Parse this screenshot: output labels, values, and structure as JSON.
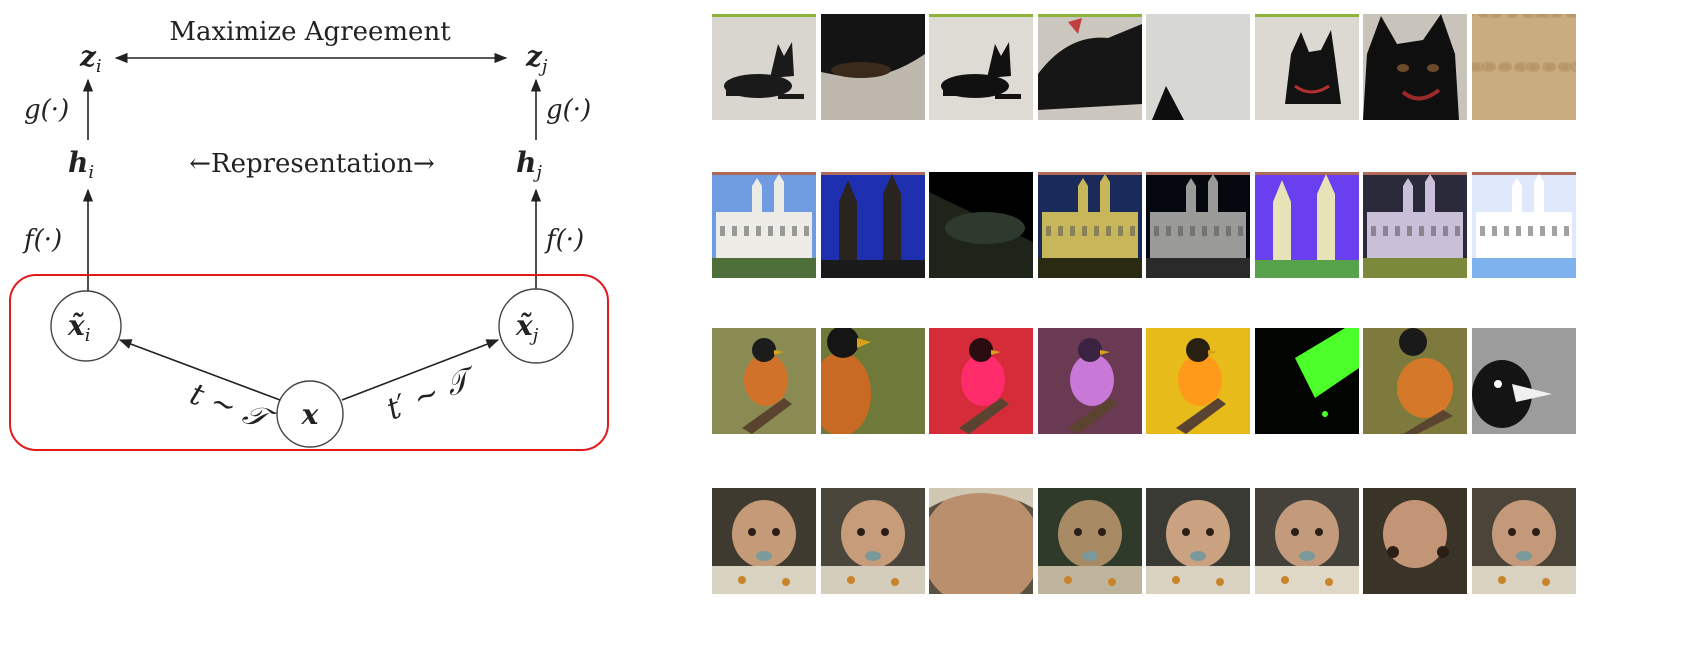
{
  "diagram": {
    "top_label": "Maximize Agreement",
    "mid_label": "←Representation→",
    "z_i": "z",
    "z_i_sub": "i",
    "z_j": "z",
    "z_j_sub": "j",
    "h_i": "h",
    "h_i_sub": "i",
    "h_j": "h",
    "h_j_sub": "j",
    "g_i": "g(·)",
    "g_j": "g(·)",
    "f_i": "f(·)",
    "f_j": "f(·)",
    "xt_i": "x̃",
    "xt_i_sub": "i",
    "xt_j": "x̃",
    "xt_j_sub": "j",
    "x": "x",
    "t_left": "t ∼ 𝒯",
    "t_right": "t′ ∼ 𝒯",
    "colors": {
      "box": "#e31a1c",
      "ink": "#222222"
    }
  },
  "augmentation_rows": [
    {
      "name": "dog",
      "tiles": [
        {
          "kind": "dog-full",
          "bg": "#d9d6cf",
          "fg": "#1a1a1a"
        },
        {
          "kind": "dog-crop-dark",
          "bg": "#bdb7ae",
          "fg": "#141414"
        },
        {
          "kind": "dog-full",
          "bg": "#dedbd4",
          "fg": "#111111"
        },
        {
          "kind": "dog-crop-side",
          "bg": "#cbc6be",
          "fg": "#161616"
        },
        {
          "kind": "dog-ear",
          "bg": "#d7d7d4",
          "fg": "#0e0e0e"
        },
        {
          "kind": "dog-head",
          "bg": "#dcd9d2",
          "fg": "#121212"
        },
        {
          "kind": "dog-head-close",
          "bg": "#c9c4bb",
          "fg": "#0f0f0f"
        },
        {
          "kind": "noise",
          "bg": "#c9ad80",
          "fg": "#b59466"
        }
      ]
    },
    {
      "name": "building",
      "tiles": [
        {
          "kind": "building",
          "sky": "#6f9be0",
          "wall": "#ecebe6",
          "ground": "#4f6f3a"
        },
        {
          "kind": "towers",
          "sky": "#1e2fb0",
          "wall": "#2a2420",
          "ground": "#1a1a1a"
        },
        {
          "kind": "cannon",
          "sky": "#000000",
          "wall": "#1e241a",
          "ground": "#2f3a2e"
        },
        {
          "kind": "building",
          "sky": "#1a2a5a",
          "wall": "#c8b65a",
          "ground": "#2a2a12"
        },
        {
          "kind": "building",
          "sky": "#06080f",
          "wall": "#9a9a98",
          "ground": "#2a2a2a"
        },
        {
          "kind": "towers-bright",
          "sky": "#6a3ff0",
          "wall": "#e8e2b8",
          "ground": "#56a24a"
        },
        {
          "kind": "building",
          "sky": "#2a2a3a",
          "wall": "#c9bfd9",
          "ground": "#7a8a3a"
        },
        {
          "kind": "building-washed",
          "sky": "#dfe9fb",
          "wall": "#ffffff",
          "ground": "#7db2ef"
        }
      ]
    },
    {
      "name": "bird",
      "tiles": [
        {
          "kind": "bird",
          "bg": "#8a8b52",
          "body": "#d1722a",
          "head": "#1c1c1c"
        },
        {
          "kind": "bird-close",
          "bg": "#6f7a3a",
          "body": "#c96a24",
          "head": "#151515"
        },
        {
          "kind": "bird",
          "bg": "#d62c3a",
          "body": "#ff2b6a",
          "head": "#2a0b10"
        },
        {
          "kind": "bird",
          "bg": "#6a3a52",
          "body": "#c878d6",
          "head": "#3a2242"
        },
        {
          "kind": "bird",
          "bg": "#e6bb1a",
          "body": "#ff9a1a",
          "head": "#2a2012"
        },
        {
          "kind": "bird-neon",
          "bg": "#020402",
          "body": "#4cff2a",
          "head": "#0a1a0a"
        },
        {
          "kind": "bird-side",
          "bg": "#7e7a3e",
          "body": "#d4782a",
          "head": "#1a1a1a"
        },
        {
          "kind": "bird-gray",
          "bg": "#9c9c9c",
          "body": "#f0f0f0",
          "head": "#141414"
        }
      ]
    },
    {
      "name": "baby",
      "tiles": [
        {
          "kind": "baby",
          "bg": "#3e3a30",
          "skin": "#c49a78",
          "cloth": "#d8d2c0"
        },
        {
          "kind": "baby",
          "bg": "#4a463c",
          "skin": "#c79c7a",
          "cloth": "#d4cdbb"
        },
        {
          "kind": "baby-head",
          "bg": "#5a5240",
          "skin": "#b98f6e",
          "cloth": "#cfc7b2"
        },
        {
          "kind": "baby",
          "bg": "#2f3a2a",
          "skin": "#a88a64",
          "cloth": "#bfb59c"
        },
        {
          "kind": "baby",
          "bg": "#3a3a34",
          "skin": "#caa282",
          "cloth": "#d9d2c0"
        },
        {
          "kind": "baby",
          "bg": "#44413a",
          "skin": "#c39b7c",
          "cloth": "#e0d8c6"
        },
        {
          "kind": "baby-eyes",
          "bg": "#3a3328",
          "skin": "#c19575",
          "cloth": "#d4cbb4"
        },
        {
          "kind": "baby",
          "bg": "#4b4438",
          "skin": "#c4997a",
          "cloth": "#dad2c0"
        }
      ]
    }
  ]
}
